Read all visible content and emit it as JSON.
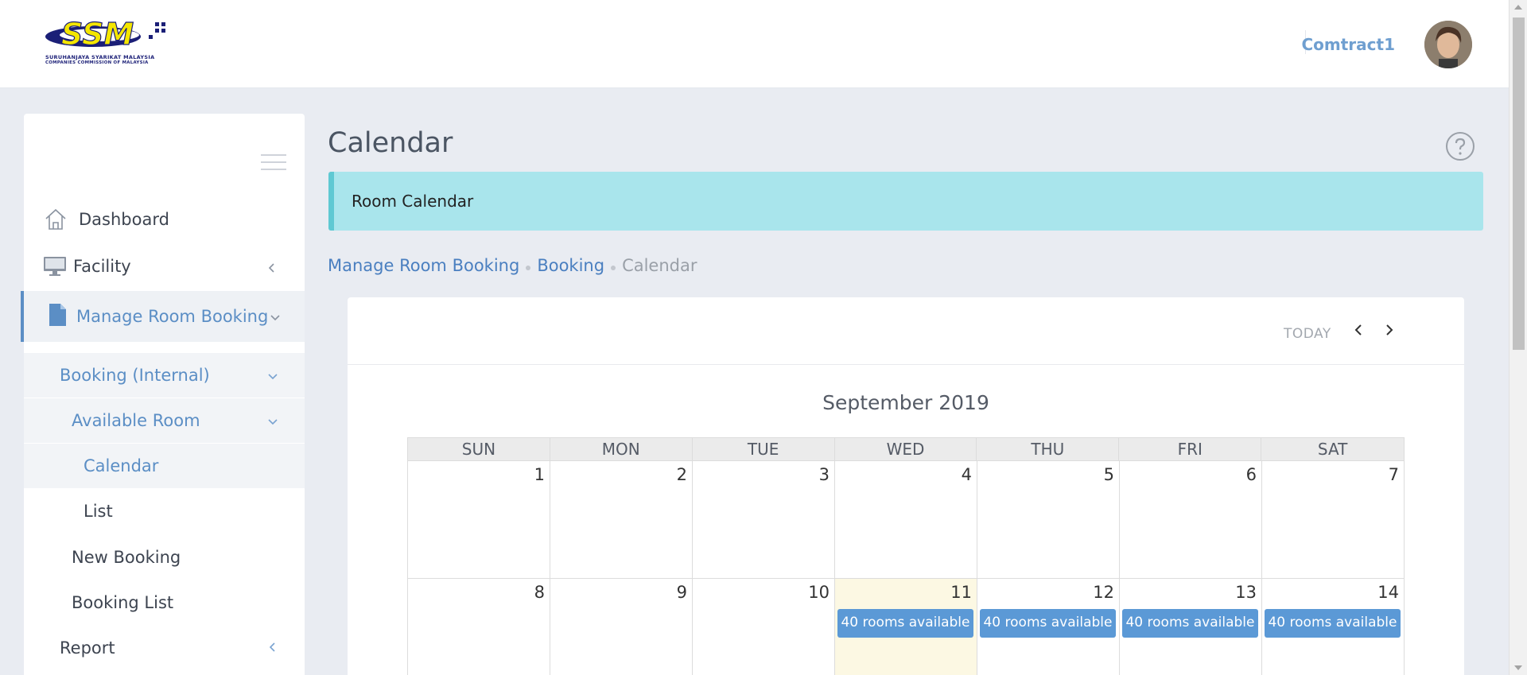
{
  "header": {
    "logo_text": "SSM",
    "logo_line1": "SURUHANJAYA SYARIKAT MALAYSIA",
    "logo_line2": "COMPANIES COMMISSION OF MALAYSIA",
    "username": "Comtract1"
  },
  "sidebar": {
    "items": [
      {
        "label": "Dashboard",
        "icon": "home-icon"
      },
      {
        "label": "Facility",
        "icon": "monitor-icon"
      },
      {
        "label": "Manage Room Booking",
        "icon": "document-icon"
      },
      {
        "label": "Booking (Internal)"
      },
      {
        "label": "Available Room"
      },
      {
        "label": "Calendar"
      },
      {
        "label": "List"
      },
      {
        "label": "New Booking"
      },
      {
        "label": "Booking List"
      },
      {
        "label": "Report"
      }
    ]
  },
  "page": {
    "title": "Calendar",
    "banner": "Room Calendar",
    "breadcrumb": [
      "Manage Room Booking",
      "Booking",
      "Calendar"
    ]
  },
  "calendar": {
    "today_label": "TODAY",
    "month_title": "September 2019",
    "weekdays": [
      "SUN",
      "MON",
      "TUE",
      "WED",
      "THU",
      "FRI",
      "SAT"
    ],
    "weeks": [
      [
        {
          "day": "1"
        },
        {
          "day": "2"
        },
        {
          "day": "3"
        },
        {
          "day": "4"
        },
        {
          "day": "5"
        },
        {
          "day": "6"
        },
        {
          "day": "7"
        }
      ],
      [
        {
          "day": "8"
        },
        {
          "day": "9"
        },
        {
          "day": "10"
        },
        {
          "day": "11",
          "event": "40 rooms available",
          "today": true
        },
        {
          "day": "12",
          "event": "40 rooms available"
        },
        {
          "day": "13",
          "event": "40 rooms available"
        },
        {
          "day": "14",
          "event": "40 rooms available"
        }
      ]
    ]
  },
  "colors": {
    "accent": "#5b8ec5",
    "event_bg": "#5b99d6",
    "banner_bg": "#a9e5ec",
    "today_bg": "#fcf8e3"
  }
}
